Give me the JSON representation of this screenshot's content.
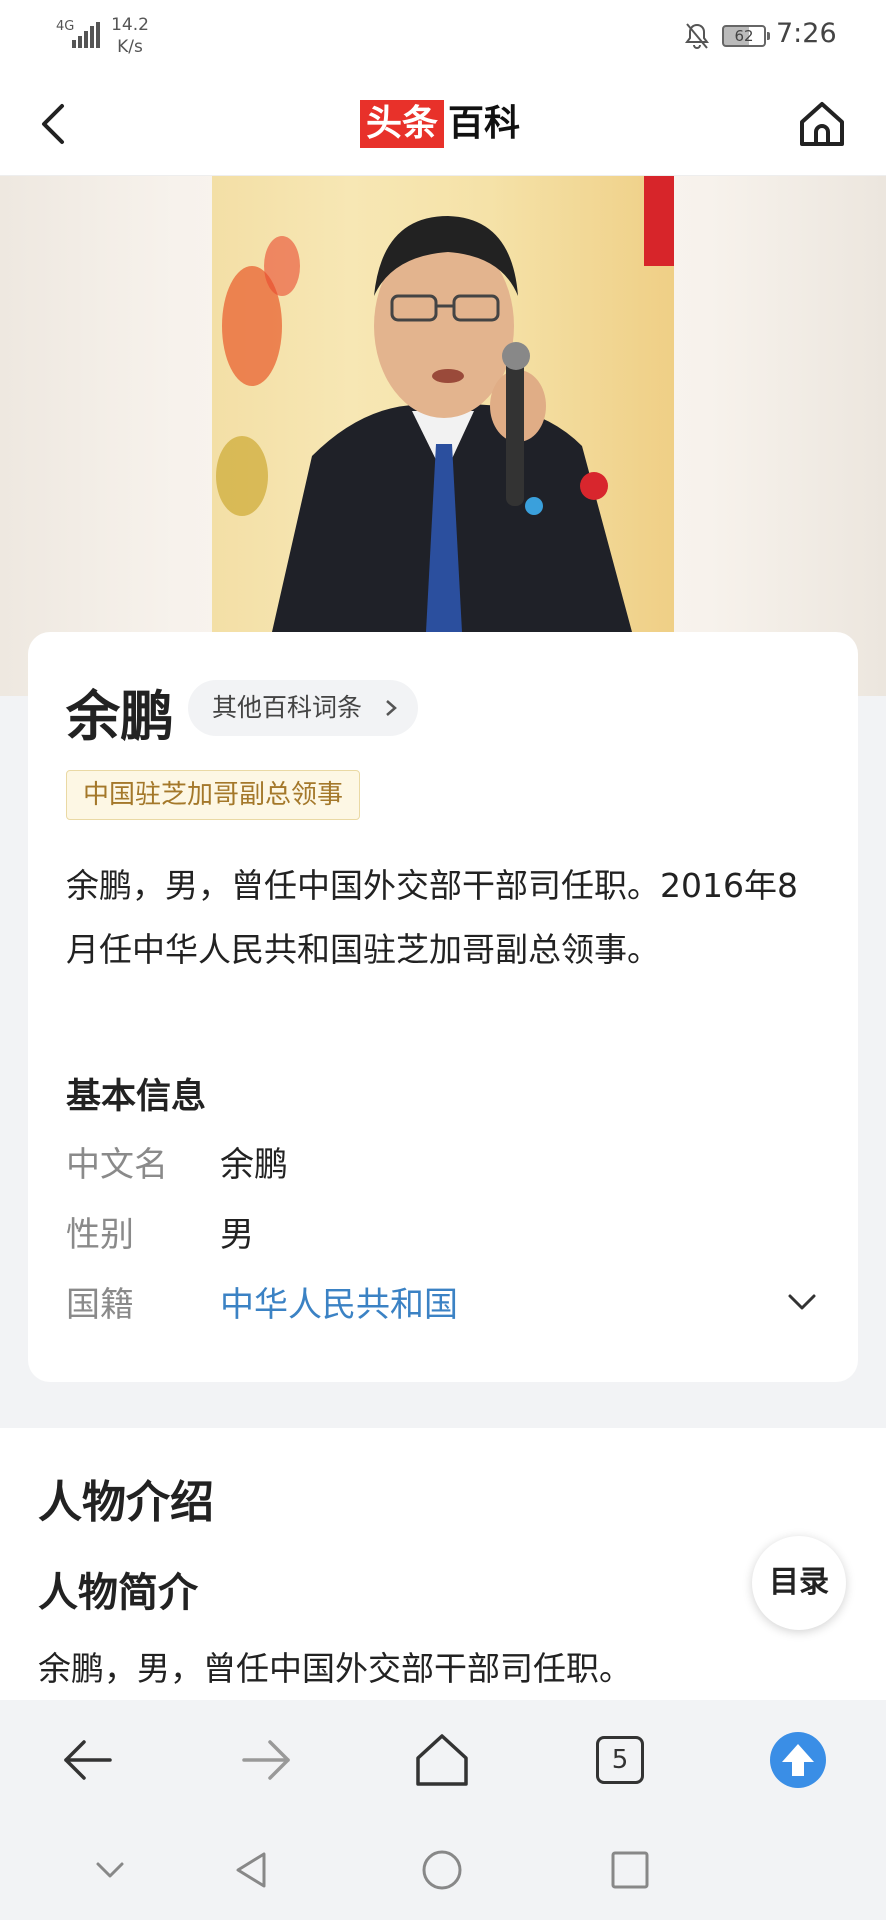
{
  "status_bar": {
    "network": "4G",
    "speed_value": "14.2",
    "speed_unit": "K/s",
    "battery": "62",
    "time": "7:26"
  },
  "header": {
    "logo_red": "头条",
    "logo_black": "百科",
    "back_icon": "chevron-left-icon",
    "home_icon": "home-icon"
  },
  "entry": {
    "title": "余鹏",
    "other_entries_label": "其他百科词条",
    "tag": "中国驻芝加哥副总领事",
    "summary": "余鹏，男，曾任中国外交部干部司任职。2016年8月任中华人民共和国驻芝加哥副总领事。",
    "basic_info_label": "基本信息",
    "basic_info": [
      {
        "key": "中文名",
        "value": "余鹏"
      },
      {
        "key": "性别",
        "value": "男"
      },
      {
        "key": "国籍",
        "value": "中华人民共和国"
      }
    ]
  },
  "article": {
    "section_title": "人物介绍",
    "subsection_title": "人物简介",
    "paragraph": "余鹏，男，曾任中国外交部干部司任职。"
  },
  "toc_label": "目录",
  "browser_bar": {
    "tabs_count": "5"
  },
  "colors": {
    "brand_red": "#e8312a",
    "link_blue": "#3b82c4",
    "tag_text": "#a4782a",
    "upload_blue": "#3a8ee6"
  }
}
